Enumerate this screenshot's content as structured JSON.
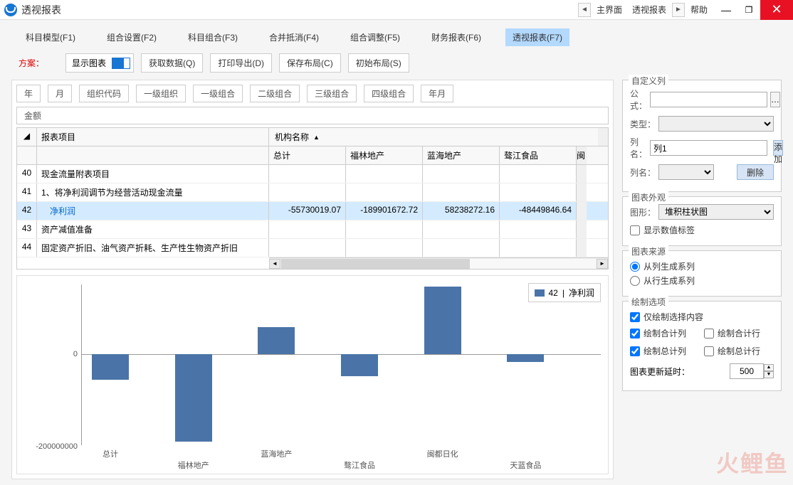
{
  "window": {
    "title": "透视报表",
    "nav_main": "主界面",
    "nav_current": "透视报表",
    "help": "帮助"
  },
  "tabs": [
    {
      "label": "科目模型(F1)"
    },
    {
      "label": "组合设置(F2)"
    },
    {
      "label": "科目组合(F3)"
    },
    {
      "label": "合并抵消(F4)"
    },
    {
      "label": "组合调整(F5)"
    },
    {
      "label": "财务报表(F6)"
    },
    {
      "label": "透视报表(F7)"
    }
  ],
  "toolbar": {
    "plan_label": "方案：",
    "show_chart": "显示图表",
    "fetch": "获取数据(Q)",
    "print": "打印导出(D)",
    "save_layout": "保存布局(C)",
    "reset_layout": "初始布局(S)"
  },
  "dims": [
    "年",
    "月",
    "组织代码",
    "一级组织",
    "一级组合",
    "二级组合",
    "三级组合",
    "四级组合",
    "年月"
  ],
  "measure": "金额",
  "grid": {
    "org_header": "机构名称",
    "item_header": "报表项目",
    "cols": [
      "总计",
      "福林地产",
      "蓝海地产",
      "骜江食品",
      "闽"
    ],
    "rows": [
      {
        "no": "40",
        "name": "现金流量附表项目"
      },
      {
        "no": "41",
        "name": "1、将净利润调节为经营活动现金流量"
      },
      {
        "no": "42",
        "name": "净利润",
        "sel": true,
        "vals": [
          "-55730019.07",
          "-18990167​2.72",
          "58238272.16",
          "-48449846.64"
        ]
      },
      {
        "no": "43",
        "name": "资产减值准备"
      },
      {
        "no": "44",
        "name": "固定资产折旧、油气资产折耗、生产性生物资产折旧"
      }
    ]
  },
  "chart_data": {
    "type": "bar",
    "categories": [
      "总计",
      "福林地产",
      "蓝海地产",
      "骜江食品",
      "闽都日化",
      "天蓝食品"
    ],
    "values": [
      -55730019,
      -189901673,
      58238272,
      -48449847,
      146000000,
      -18000000
    ],
    "ylim": [
      -200000000,
      150000000
    ],
    "yticks": [
      0,
      -200000000
    ],
    "legend": {
      "code": "42",
      "name": "净利润"
    }
  },
  "custom_col": {
    "title": "自定义列",
    "formula": "公式：",
    "type": "类型：",
    "colname": "列名：",
    "col_value": "列1",
    "add": "添加",
    "delete": "删除"
  },
  "appearance": {
    "title": "图表外观",
    "shape": "图形：",
    "shape_value": "堆积柱状图",
    "show_labels": "显示数值标签"
  },
  "source": {
    "title": "图表来源",
    "from_col": "从列生成系列",
    "from_row": "从行生成系列"
  },
  "draw": {
    "title": "绘制选项",
    "only_sel": "仅绘制选择内容",
    "sum_col": "绘制合计列",
    "sum_row": "绘制合计行",
    "total_col": "绘制总计列",
    "total_row": "绘制总计行",
    "delay_label": "图表更新延时：",
    "delay_value": "500"
  },
  "watermark": "火鲤鱼"
}
